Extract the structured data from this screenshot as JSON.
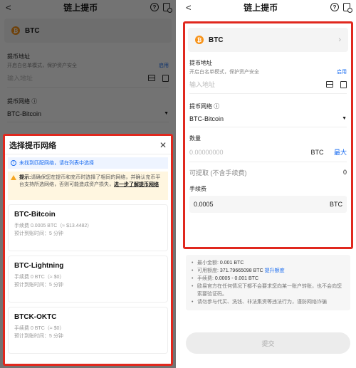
{
  "header": {
    "back": "<",
    "title": "链上提币"
  },
  "coin": {
    "symbol": "BTC",
    "icon_letter": "₿"
  },
  "address": {
    "label": "提币地址",
    "subtitle": "开启白名单模式，保护资产安全",
    "enable_link": "启用",
    "placeholder": "输入地址"
  },
  "network": {
    "label": "提币网络",
    "info_mark": "ⓘ",
    "selected": "BTC-Bitcoin"
  },
  "sheet": {
    "title": "选择提币网络",
    "notice": "未找到匹配网络，请在列表中选择",
    "warning_prefix": "提示:",
    "warning_text": "请确保您在提币和充币时选择了相同的网络，并确认充币平台支持所选网络，否则可能造成资产损失",
    "warning_link": "进一步了解提币网络",
    "items": [
      {
        "name": "BTC-Bitcoin",
        "fee": "手续费 0.0005 BTC（≈ $13.4482）",
        "eta": "预计到账时间：5 分钟"
      },
      {
        "name": "BTC-Lightning",
        "fee": "手续费 0 BTC（≈ $0）",
        "eta": "预计到账时间：5 分钟"
      },
      {
        "name": "BTCK-OKTC",
        "fee": "手续费 0 BTC（≈ $0）",
        "eta": "预计到账时间：5 分钟"
      }
    ]
  },
  "amount": {
    "label": "数量",
    "placeholder": "0.00000000",
    "unit": "BTC",
    "max": "最大",
    "receivable_label": "可提取 (不含手续费)",
    "receivable_value": "0"
  },
  "fee": {
    "label": "手续费",
    "value": "0.0005",
    "unit": "BTC"
  },
  "notes": {
    "min": {
      "label": "最小金额:",
      "value": "0.001 BTC"
    },
    "quota": {
      "label": "可用额度:",
      "value": "371.79665098 BTC",
      "link": "提升额度"
    },
    "fee": {
      "label": "手续费:",
      "value": "0.0005 - 0.001 BTC"
    },
    "n4": "欧易官方在任何情况下都不会要求您向某一账户转账，也不会向您索要验证码。",
    "n5": "请勿参与代买、洗钱、非法集资等违法行为，谨防网络诈骗"
  },
  "submit_label": "提交",
  "colors": {
    "accent": "#1a6cf0",
    "highlight": "#e0281e",
    "btc": "#f7931a"
  }
}
